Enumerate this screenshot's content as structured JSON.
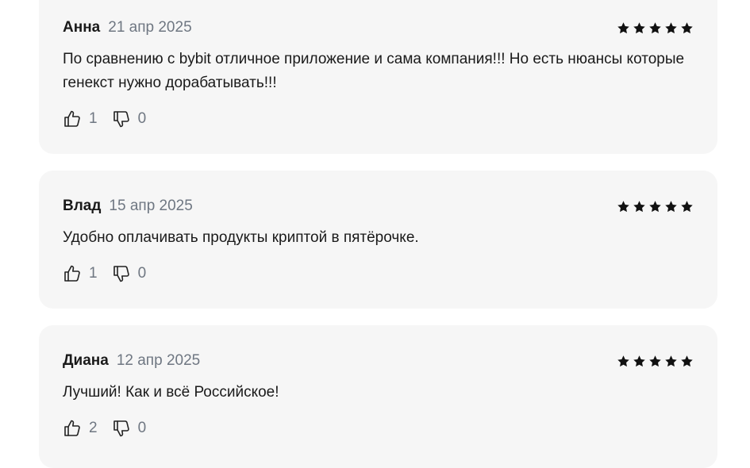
{
  "reviews": [
    {
      "author": "Анна",
      "date": "21 апр 2025",
      "rating": 5,
      "text": "По сравнению с bybit отличное приложение и сама компания!!! Но есть нюансы которые генекст нужно дорабатывать!!!",
      "likes": "1",
      "dislikes": "0"
    },
    {
      "author": "Влад",
      "date": "15 апр 2025",
      "rating": 5,
      "text": "Удобно оплачивать продукты криптой в пятёрочке.",
      "likes": "1",
      "dislikes": "0"
    },
    {
      "author": "Диана",
      "date": "12 апр 2025",
      "rating": 5,
      "text": "Лучший! Как и всё Российское!",
      "likes": "2",
      "dislikes": "0"
    }
  ],
  "icons": {
    "like": "thumbs-up-icon",
    "dislike": "thumbs-down-icon",
    "star": "star-icon"
  },
  "colors": {
    "card_background": "#f6f6f6",
    "text": "#1a1a1a",
    "muted": "#6f7782",
    "star": "#111111"
  }
}
